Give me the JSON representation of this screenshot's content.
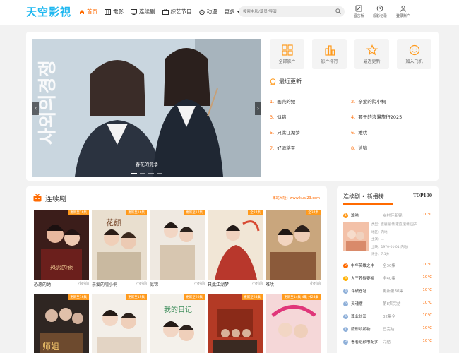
{
  "header": {
    "logo": "天空影視",
    "nav": [
      {
        "label": "首页",
        "icon": "home-icon"
      },
      {
        "label": "電影",
        "icon": "film-icon"
      },
      {
        "label": "连续剧",
        "icon": "tv-icon"
      },
      {
        "label": "综艺节目",
        "icon": "variety-icon"
      },
      {
        "label": "动漫",
        "icon": "anime-icon"
      },
      {
        "label": "更多",
        "icon": "chevron-down-icon"
      }
    ],
    "search_placeholder": "搜索电影/演员/导演",
    "buttons": [
      {
        "label": "留言板",
        "icon": "message-icon"
      },
      {
        "label": "观影记录",
        "icon": "history-icon"
      },
      {
        "label": "登录账户",
        "icon": "user-icon"
      }
    ]
  },
  "hero": {
    "caption": "春花的竞争",
    "quick_links": [
      {
        "label": "全部影片",
        "icon": "grid-icon"
      },
      {
        "label": "影片排行",
        "icon": "chart-icon"
      },
      {
        "label": "最近更新",
        "icon": "star-icon"
      },
      {
        "label": "加入飞机",
        "icon": "smile-icon"
      }
    ],
    "recent_title": "最近更新",
    "recent_items": [
      {
        "num": "1.",
        "title": "画壳的她"
      },
      {
        "num": "2.",
        "title": "亲爱的院小桐"
      },
      {
        "num": "3.",
        "title": "似锦"
      },
      {
        "num": "4.",
        "title": "要子的浪漫旅行2025"
      },
      {
        "num": "5.",
        "title": "只此江湖梦"
      },
      {
        "num": "6.",
        "title": "难哄"
      },
      {
        "num": "7.",
        "title": "好运将至"
      },
      {
        "num": "8.",
        "title": "逍镐"
      }
    ]
  },
  "series": {
    "title": "连续剧",
    "url": "本站网址：www.kuai23.com",
    "row1": [
      {
        "badge": "更新至16集",
        "title": "恐恶的她",
        "extra": "小时前"
      },
      {
        "badge": "更新至16集",
        "title": "亲爱的院小桐",
        "extra": "小时前"
      },
      {
        "badge": "更新至17集",
        "title": "似锦",
        "extra": "小时前"
      },
      {
        "badge": "全24集",
        "title": "只此江湖梦",
        "extra": "小时前"
      },
      {
        "badge": "全34集",
        "title": "难哄",
        "extra": "小时前"
      }
    ],
    "row2": [
      {
        "badge": "更新至16集"
      },
      {
        "badge": "更新至15集"
      },
      {
        "badge": "更新至20集"
      },
      {
        "badge": "更新至24集"
      },
      {
        "badge": "更新至14集·4集 共24集"
      }
    ]
  },
  "ranking": {
    "title": "连续剧 • 新播榜",
    "top": "TOP100",
    "first": {
      "num": "1",
      "title": "难哄",
      "extra": "乡村佳新完"
    },
    "detail_lines": [
      "类型：喜剧,剧情,家庭,爱情,国产",
      "地区：内地",
      "主演：...",
      "上映：1970-01-01(内地)",
      "评分：7.1分"
    ],
    "rows": [
      {
        "num": "1",
        "title": "难哄",
        "extra": "乡村佳新完",
        "deg": "10°C"
      },
      {
        "num": "2",
        "title": "中华英雄之中",
        "extra": "全30集",
        "deg": "10°C"
      },
      {
        "num": "3",
        "title": "大王养得要碰",
        "extra": "全40集",
        "deg": "10°C"
      },
      {
        "num": "4",
        "title": "斗破苍穹",
        "extra": "更新第30集",
        "deg": "10°C"
      },
      {
        "num": "5",
        "title": "灵魂摆",
        "extra": "第8集完结",
        "deg": "10°C"
      },
      {
        "num": "6",
        "title": "尊业长江",
        "extra": "32集全",
        "deg": "10°C"
      },
      {
        "num": "7",
        "title": "蔚形娇娇物",
        "extra": "已完结",
        "deg": "10°C"
      },
      {
        "num": "8",
        "title": "看着给颜嘟配爹",
        "extra": "完结",
        "deg": "10°C"
      }
    ],
    "rank_colors": [
      "#ff9a1c",
      "#ff6a00",
      "#ffb000",
      "#8fb0d9"
    ]
  },
  "colors": {
    "accent": "#ff6a00",
    "logo": "#20b8f0"
  }
}
